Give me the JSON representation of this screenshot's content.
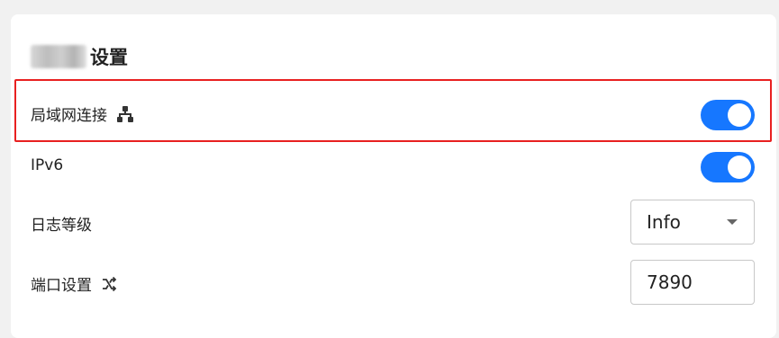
{
  "settings": {
    "title": "设置",
    "lan": {
      "label": "局域网连接",
      "icon": "network-icon",
      "enabled": true
    },
    "ipv6": {
      "label": "IPv6",
      "enabled": true
    },
    "log_level": {
      "label": "日志等级",
      "value": "Info"
    },
    "port": {
      "label": "端口设置",
      "icon": "shuffle-icon",
      "value": "7890"
    }
  },
  "colors": {
    "accent": "#1677ff",
    "highlight": "#e82020"
  }
}
